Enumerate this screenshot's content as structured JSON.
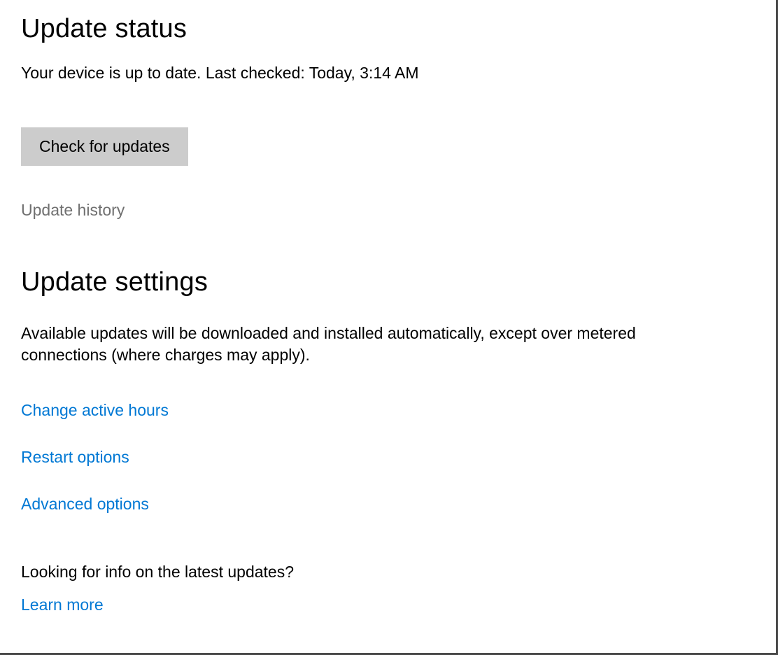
{
  "update_status": {
    "heading": "Update status",
    "status_text": "Your device is up to date. Last checked: Today, 3:14 AM",
    "check_button_label": "Check for updates",
    "history_link_label": "Update history"
  },
  "update_settings": {
    "heading": "Update settings",
    "description": "Available updates will be downloaded and installed automatically, except over metered connections (where charges may apply).",
    "links": {
      "change_active_hours": "Change active hours",
      "restart_options": "Restart options",
      "advanced_options": "Advanced options"
    },
    "info_prompt": "Looking for info on the latest updates?",
    "learn_more_label": "Learn more"
  }
}
